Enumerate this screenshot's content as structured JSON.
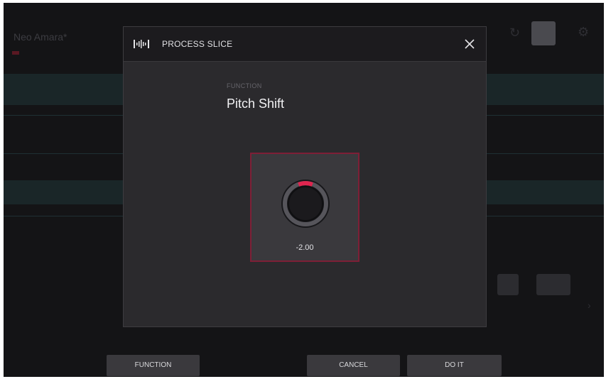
{
  "background": {
    "title": "Neo Amara*",
    "footer_labels": [
      "",
      "",
      ""
    ]
  },
  "modal": {
    "title": "PROCESS SLICE",
    "header_icon": "waveform-icon",
    "close_icon": "close-icon",
    "function_label": "FUNCTION",
    "function_value": "Pitch Shift",
    "knob": {
      "value_text": "-2.00",
      "accent_color": "#e0254f",
      "icon": "knob"
    }
  },
  "footer": {
    "function_label": "FUNCTION",
    "cancel_label": "CANCEL",
    "doit_label": "DO IT"
  },
  "colors": {
    "accent": "#e0254f",
    "panel_border": "#7e1f36",
    "modal_bg": "#2b2a2d"
  }
}
